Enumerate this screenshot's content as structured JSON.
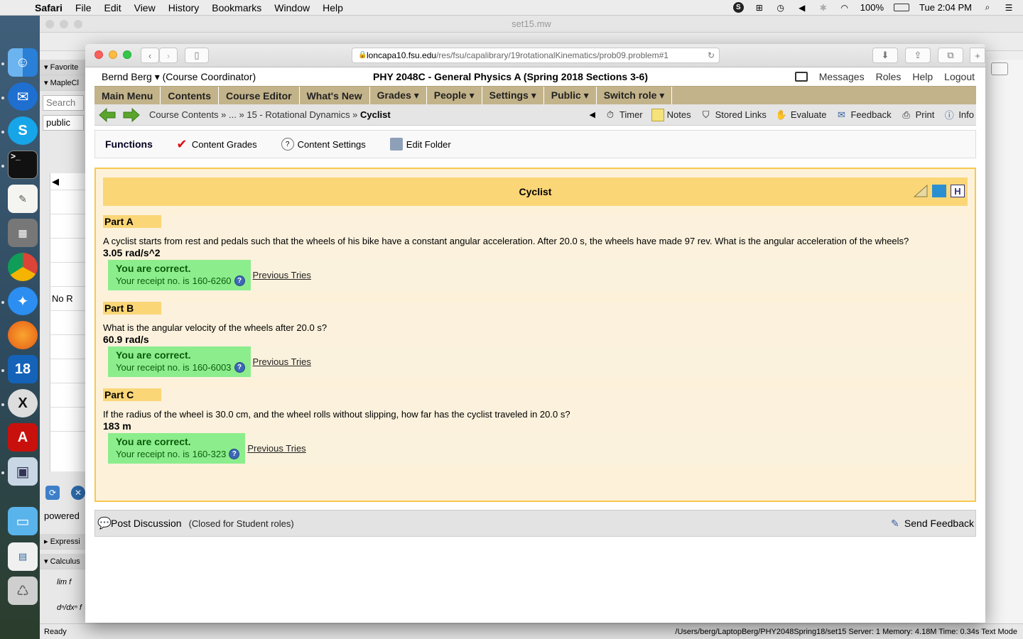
{
  "mac_menu": {
    "app": "Safari",
    "items": [
      "File",
      "Edit",
      "View",
      "History",
      "Bookmarks",
      "Window",
      "Help"
    ],
    "battery": "100%",
    "clock": "Tue 2:04 PM"
  },
  "maple": {
    "title": "set15.mw",
    "palettes": [
      "Favorite",
      "MapleCl"
    ],
    "search_placeholder": "Search",
    "public_label": "public",
    "no_results": "No R",
    "powered": "powered",
    "palette_expr": "Expressi",
    "palette_calc": "Calculus",
    "calc_lim": "lim",
    "calc_d": "d",
    "status_left": "Ready",
    "status_right": "/Users/berg/LaptopBerg/PHY2048Spring18/set15   Server: 1   Memory: 4.18M   Time: 0.34s   Text Mode"
  },
  "safari": {
    "url_host": "loncapa10.fsu.edu",
    "url_path": "/res/fsu/capalibrary/19rotationalKinematics/prob09.problem#1"
  },
  "user": {
    "name": "Bernd Berg",
    "role": "(Course Coordinator)",
    "course": "PHY 2048C - General Physics A (Spring 2018 Sections 3-6)",
    "links": [
      "Messages",
      "Roles",
      "Help",
      "Logout"
    ]
  },
  "main_menu": [
    "Main Menu",
    "Contents",
    "Course Editor",
    "What's New",
    "Grades ▾",
    "People ▾",
    "Settings ▾",
    "Public ▾",
    "Switch role ▾"
  ],
  "breadcrumb": {
    "parts": [
      "Course Contents »",
      "... »",
      "15 - Rotational Dynamics »"
    ],
    "current": "Cyclist"
  },
  "tools": [
    "Timer",
    "Notes",
    "Stored Links",
    "Evaluate",
    "Feedback",
    "Print",
    "Info"
  ],
  "functions": {
    "title": "Functions",
    "items": [
      "Content Grades",
      "Content Settings",
      "Edit Folder"
    ]
  },
  "problem": {
    "title": "Cyclist",
    "correct_label": "You are correct.",
    "receipt_prefix": "Your receipt no. is",
    "prev_tries": "Previous Tries",
    "parts": [
      {
        "label": "Part A",
        "question": "A cyclist starts from rest and pedals such that the wheels of his bike have a constant angular acceleration. After 20.0 s, the wheels have made 97 rev. What is the angular acceleration of the wheels?",
        "answer": "3.05 rad/s^2",
        "receipt": "160-6260"
      },
      {
        "label": "Part B",
        "question": "What is the angular velocity of the wheels after 20.0 s?",
        "answer": "60.9 rad/s",
        "receipt": "160-6003"
      },
      {
        "label": "Part C",
        "question": "If the radius of the wheel is 30.0 cm, and the wheel rolls without slipping, how far has the cyclist traveled in 20.0 s?",
        "answer": "183 m",
        "receipt": "160-323"
      }
    ]
  },
  "footer": {
    "post": "Post Discussion",
    "closed": "(Closed for Student roles)",
    "send": "Send Feedback"
  }
}
